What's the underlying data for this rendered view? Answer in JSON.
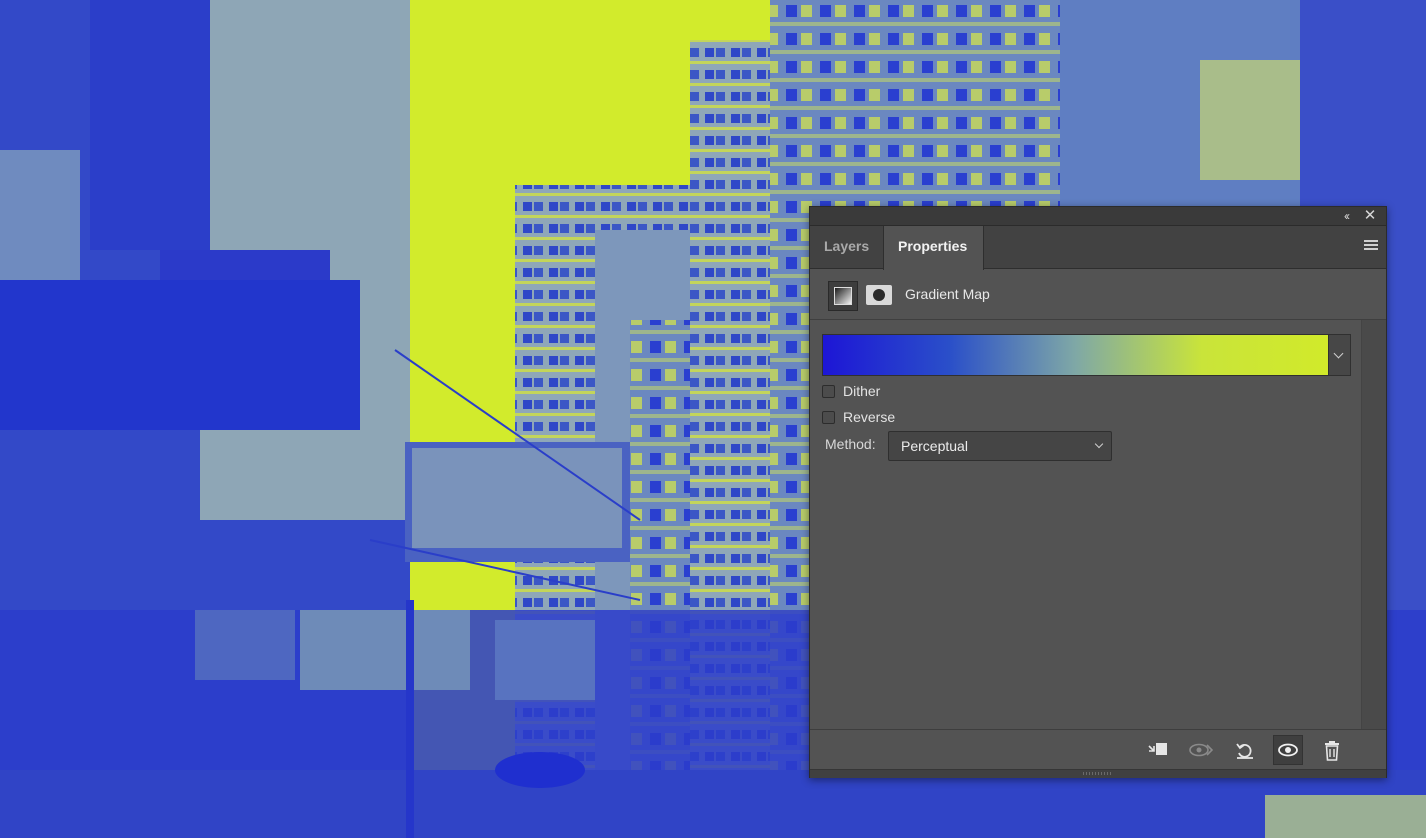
{
  "colors": {
    "gradient_start": "#1d16d6",
    "gradient_end": "#d1ea2a",
    "panel_bg": "#535353",
    "tab_bar_bg": "#424242"
  },
  "titlebar": {
    "collapse_icon": "double-chevron-left-icon",
    "close_icon": "close-icon"
  },
  "tabs": [
    {
      "label": "Layers",
      "active": false
    },
    {
      "label": "Properties",
      "active": true
    }
  ],
  "panel_menu_icon": "hamburger-menu-icon",
  "adjustment": {
    "title": "Gradient Map",
    "adjustment_icon": "gradient-map-adjustment-icon",
    "mask_icon": "layer-mask-icon"
  },
  "gradient": {
    "stops": [
      "#1d16d6",
      "#2a4fc9",
      "#7fa8a6",
      "#c9e43a",
      "#d1ea2a"
    ]
  },
  "options": {
    "dither": {
      "label": "Dither",
      "checked": false
    },
    "reverse": {
      "label": "Reverse",
      "checked": false
    },
    "method": {
      "label": "Method:",
      "value": "Perceptual"
    }
  },
  "footer_buttons": [
    {
      "name": "clip-to-layer-icon"
    },
    {
      "name": "view-previous-state-icon"
    },
    {
      "name": "reset-icon"
    },
    {
      "name": "toggle-visibility-icon"
    },
    {
      "name": "delete-icon"
    }
  ]
}
